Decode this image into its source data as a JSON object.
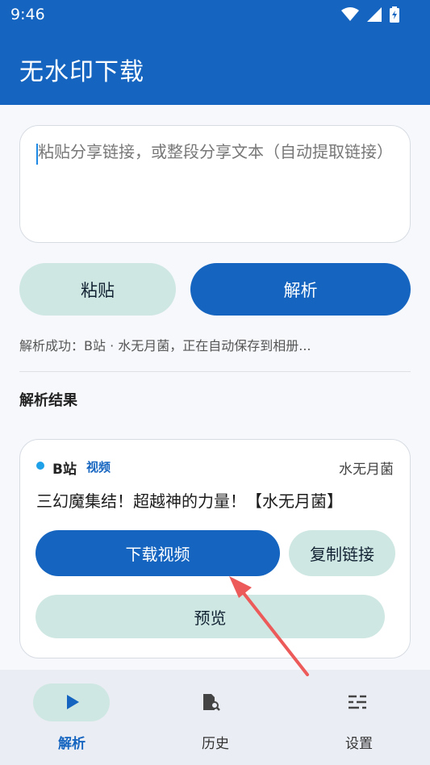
{
  "status_bar": {
    "time": "9:46",
    "icons": [
      "wifi-icon",
      "signal-icon",
      "battery-icon"
    ]
  },
  "app": {
    "title": "无水印下载"
  },
  "input": {
    "placeholder": "粘贴分享链接，或整段分享文本（自动提取链接）"
  },
  "buttons": {
    "paste": "粘贴",
    "parse": "解析"
  },
  "status_message": "解析成功：B站 · 水无月菌，正在自动保存到相册...",
  "results": {
    "section_title": "解析结果",
    "item": {
      "platform": "B站",
      "type": "视频",
      "author": "水无月菌",
      "title": "三幻魔集结！超越神的力量！【水无月菌】",
      "download_label": "下载视频",
      "copy_label": "复制链接",
      "preview_label": "预览"
    }
  },
  "nav": {
    "items": [
      {
        "label": "解析",
        "icon": "play-icon",
        "active": true
      },
      {
        "label": "历史",
        "icon": "history-icon",
        "active": false
      },
      {
        "label": "设置",
        "icon": "settings-icon",
        "active": false
      }
    ]
  },
  "colors": {
    "primary": "#1565c0",
    "secondary_container": "#cfe7e2",
    "annotation_arrow": "#ec5a5a"
  }
}
